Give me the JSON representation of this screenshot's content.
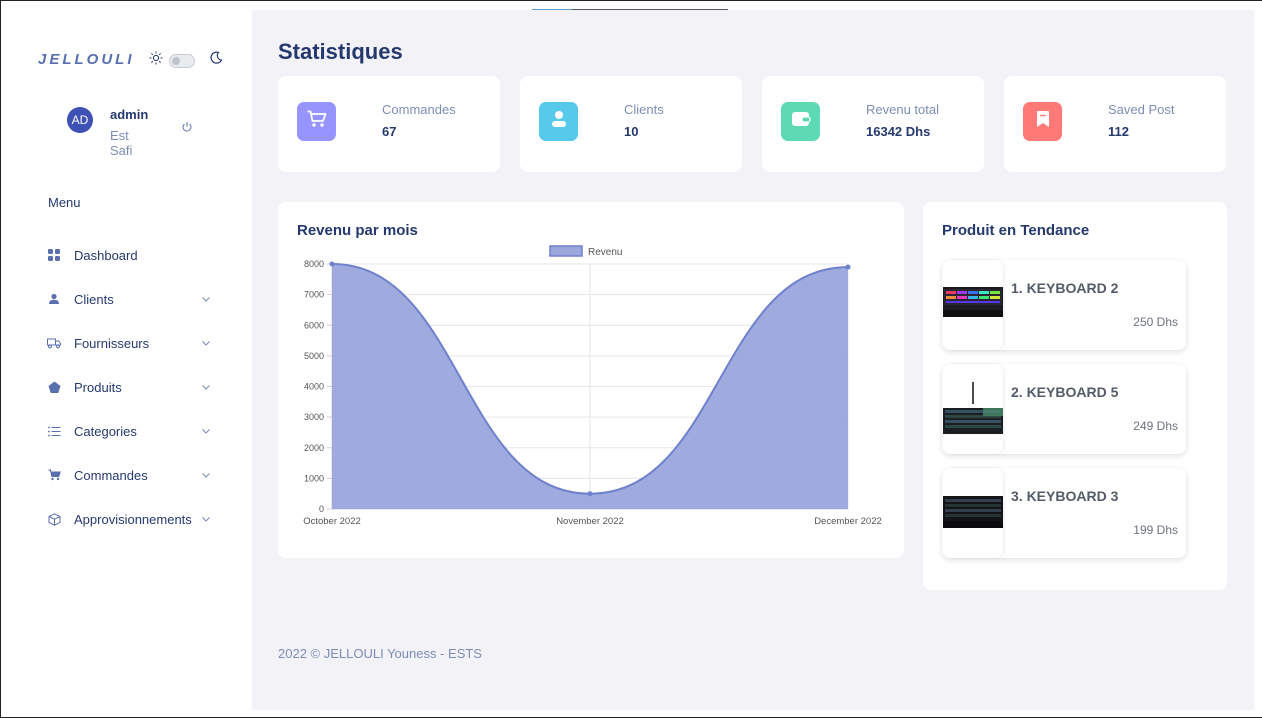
{
  "brand": "JELLOULI",
  "user": {
    "initials": "AD",
    "name": "admin",
    "location": "Est Safi"
  },
  "menu": {
    "title": "Menu",
    "items": [
      {
        "label": "Dashboard",
        "icon": "grid-icon",
        "has_children": false
      },
      {
        "label": "Clients",
        "icon": "person-icon",
        "has_children": true
      },
      {
        "label": "Fournisseurs",
        "icon": "truck-icon",
        "has_children": true
      },
      {
        "label": "Produits",
        "icon": "pentagon-icon",
        "has_children": true
      },
      {
        "label": "Categories",
        "icon": "list-icon",
        "has_children": true
      },
      {
        "label": "Commandes",
        "icon": "cart-icon",
        "has_children": true
      },
      {
        "label": "Approvisionnements",
        "icon": "box-icon",
        "has_children": true
      }
    ]
  },
  "page": {
    "title": "Statistiques"
  },
  "stats": [
    {
      "label": "Commandes",
      "value": "67",
      "color": "#9694ff",
      "icon": "cart-icon"
    },
    {
      "label": "Clients",
      "value": "10",
      "color": "#57caeb",
      "icon": "person-icon"
    },
    {
      "label": "Revenu total",
      "value": "16342 Dhs",
      "color": "#5ddab4",
      "icon": "wallet-icon"
    },
    {
      "label": "Saved Post",
      "value": "112",
      "color": "#ff7976",
      "icon": "bookmark-icon"
    }
  ],
  "revenue_card": {
    "title": "Revenu par mois"
  },
  "chart_data": {
    "type": "area",
    "categories": [
      "October 2022",
      "November 2022",
      "December 2022"
    ],
    "series": [
      {
        "name": "Revenu",
        "values": [
          8000,
          500,
          7900
        ]
      }
    ],
    "ylim": [
      0,
      8000
    ],
    "yticks": [
      0,
      1000,
      2000,
      3000,
      4000,
      5000,
      6000,
      7000,
      8000
    ],
    "legend": "top",
    "grid": true,
    "fill_color": "#9aa6dc",
    "line_color": "#6f80cd"
  },
  "trending": {
    "title": "Produit en Tendance",
    "items": [
      {
        "name": "1. KEYBOARD 2",
        "price": "250 Dhs"
      },
      {
        "name": "2. KEYBOARD 5",
        "price": "249 Dhs"
      },
      {
        "name": "3. KEYBOARD 3",
        "price": "199 Dhs"
      }
    ]
  },
  "footer": "2022 © JELLOULI Youness - ESTS"
}
